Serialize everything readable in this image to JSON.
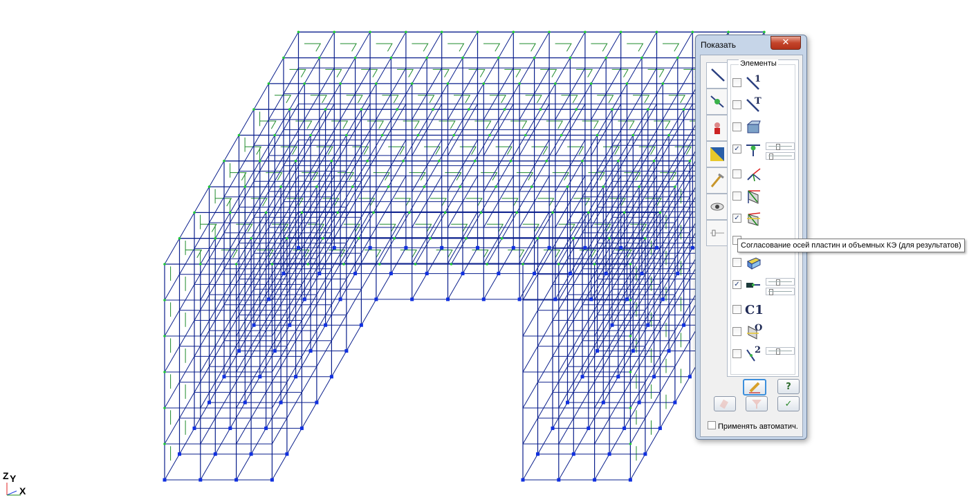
{
  "dialog": {
    "title": "Показать",
    "close_glyph": "✕",
    "group_title": "Элементы",
    "tabs": [
      {
        "name": "elements-tab",
        "icon": "bar-element-icon",
        "active": true
      },
      {
        "name": "nodes-tab",
        "icon": "node-bar-icon"
      },
      {
        "name": "loads-tab",
        "icon": "load-person-icon"
      },
      {
        "name": "fill-tab",
        "icon": "color-fill-icon"
      },
      {
        "name": "draw-tab",
        "icon": "pencil-hammer-icon"
      },
      {
        "name": "view-tab",
        "icon": "eye-icon"
      },
      {
        "name": "slider-tab",
        "icon": "slider-icon"
      }
    ],
    "rows": [
      {
        "name": "element-numbers",
        "checked": false,
        "icon": "bar-number-icon",
        "glyph": "1"
      },
      {
        "name": "element-types",
        "checked": false,
        "icon": "bar-type-icon",
        "glyph": "T"
      },
      {
        "name": "section-shapes",
        "checked": false,
        "icon": "section-profile-icon",
        "glyph": ""
      },
      {
        "name": "hinges",
        "checked": true,
        "icon": "hinge-icon",
        "glyph": "",
        "sliders": 2
      },
      {
        "name": "local-axes",
        "checked": false,
        "icon": "local-axes-icon",
        "glyph": ""
      },
      {
        "name": "plate-axes",
        "checked": false,
        "icon": "plate-axes-icon",
        "glyph": ""
      },
      {
        "name": "plate-axes-results",
        "checked": true,
        "icon": "plate-axes-results-icon",
        "glyph": ""
      },
      {
        "name": "hidden-row",
        "checked": false,
        "icon": "",
        "glyph": ""
      },
      {
        "name": "solid-elements",
        "checked": false,
        "icon": "solid-box-icon",
        "glyph": ""
      },
      {
        "name": "rigid-inserts",
        "checked": true,
        "icon": "rigid-insert-icon",
        "glyph": "",
        "sliders": 2
      },
      {
        "name": "c1-label",
        "checked": false,
        "icon": "c1-icon",
        "glyph": "C1"
      },
      {
        "name": "orientation",
        "checked": false,
        "icon": "orientation-icon",
        "glyph": "O"
      },
      {
        "name": "element-length",
        "checked": false,
        "icon": "length-icon",
        "glyph": "2",
        "sliders": 1
      }
    ],
    "buttons": [
      {
        "name": "draw-button",
        "icon": "pencil-icon",
        "active": true
      },
      {
        "name": "help-button",
        "icon": "question-icon",
        "label": "?"
      },
      {
        "name": "eraser-button",
        "icon": "eraser-icon"
      },
      {
        "name": "filter-button",
        "icon": "filter-icon"
      },
      {
        "name": "apply-button",
        "icon": "checkmark-icon",
        "label": "✓"
      }
    ],
    "auto_apply_label": "Применять автоматич."
  },
  "tooltip": "Согласование осей пластин и объемных КЭ (для результатов)",
  "axes": {
    "z": "Z",
    "y": "Y",
    "x": "X"
  },
  "colors": {
    "frame": "#0a1f8c",
    "node": "#22c83a",
    "support": "#1030e0",
    "slab_mark": "#1d8a2a",
    "axis_z": "#e02020",
    "axis_y": "#2040e0",
    "axis_x": "#1a8a1a"
  }
}
